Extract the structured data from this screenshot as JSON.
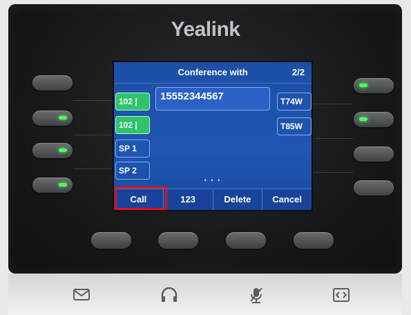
{
  "brand": {
    "logo_text": "Yealink"
  },
  "screen": {
    "title": "Conference with",
    "pager": "2/2",
    "number_field": "15552344567",
    "left_labels": [
      {
        "label": "102 |",
        "active": true
      },
      {
        "label": "102 |",
        "active": true
      },
      {
        "label": "SP 1",
        "active": false
      },
      {
        "label": "SP 2",
        "active": false
      }
    ],
    "right_labels": [
      {
        "label": "T74W"
      },
      {
        "label": "T85W"
      }
    ],
    "page_dots": "• • •",
    "softkeys": [
      "Call",
      "123",
      "Delete",
      "Cancel"
    ],
    "highlight_color": "#e5121c"
  },
  "colors": {
    "screen_blue": "#1f56b4",
    "led_green": "#4cff5a",
    "active_label_green": "#2fc36a"
  },
  "icons": {
    "message": "envelope-icon",
    "headset": "headset-icon",
    "mute": "mic-mute-icon",
    "transfer": "transfer-icon"
  }
}
